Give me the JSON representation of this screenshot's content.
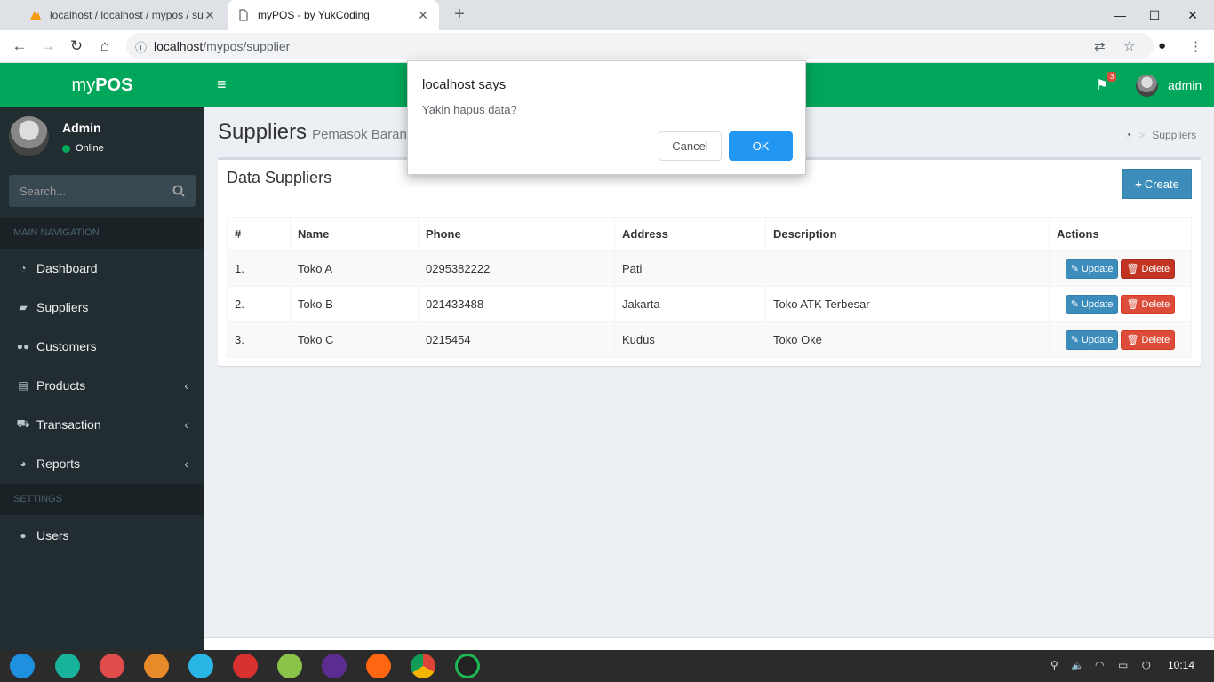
{
  "browser": {
    "tabs": [
      {
        "title": "localhost / localhost / mypos / su"
      },
      {
        "title": "myPOS - by YukCoding"
      }
    ],
    "url_host": "localhost",
    "url_path": "/mypos/supplier"
  },
  "app": {
    "logo_light": "my",
    "logo_bold": "POS",
    "user_name": "Admin",
    "user_status": "Online",
    "search_placeholder": "Search...",
    "top_user": "admin",
    "notif_count": "3"
  },
  "sidebar": {
    "main_header": "MAIN NAVIGATION",
    "settings_header": "SETTINGS",
    "items": [
      {
        "label": "Dashboard",
        "icon": "dashboard-icon"
      },
      {
        "label": "Suppliers",
        "icon": "truck-icon"
      },
      {
        "label": "Customers",
        "icon": "users-icon"
      },
      {
        "label": "Products",
        "icon": "archive-icon"
      },
      {
        "label": "Transaction",
        "icon": "cart-icon"
      },
      {
        "label": "Reports",
        "icon": "pie-chart-icon"
      },
      {
        "label": "Users",
        "icon": "user-icon"
      }
    ]
  },
  "page": {
    "title": "Suppliers",
    "subtitle": "Pemasok Barang",
    "breadcrumb_current": "Suppliers"
  },
  "box": {
    "title": "Data Suppliers",
    "create_label": "Create",
    "columns": [
      "#",
      "Name",
      "Phone",
      "Address",
      "Description",
      "Actions"
    ],
    "rows": [
      {
        "no": "1.",
        "name": "Toko A",
        "phone": "0295382222",
        "address": "Pati",
        "description": ""
      },
      {
        "no": "2.",
        "name": "Toko B",
        "phone": "021433488",
        "address": "Jakarta",
        "description": "Toko ATK Terbesar"
      },
      {
        "no": "3.",
        "name": "Toko C",
        "phone": "0215454",
        "address": "Kudus",
        "description": "Toko Oke"
      }
    ],
    "update_label": "Update",
    "delete_label": "Delete"
  },
  "dialog": {
    "title": "localhost says",
    "message": "Yakin hapus data?",
    "cancel_label": "Cancel",
    "ok_label": "OK"
  },
  "taskbar": {
    "clock": "10:14"
  },
  "colors": {
    "brand_green": "#00a65a",
    "sidebar_dark": "#222d32",
    "primary_blue": "#3c8dbc",
    "danger_red": "#dd4b39"
  }
}
